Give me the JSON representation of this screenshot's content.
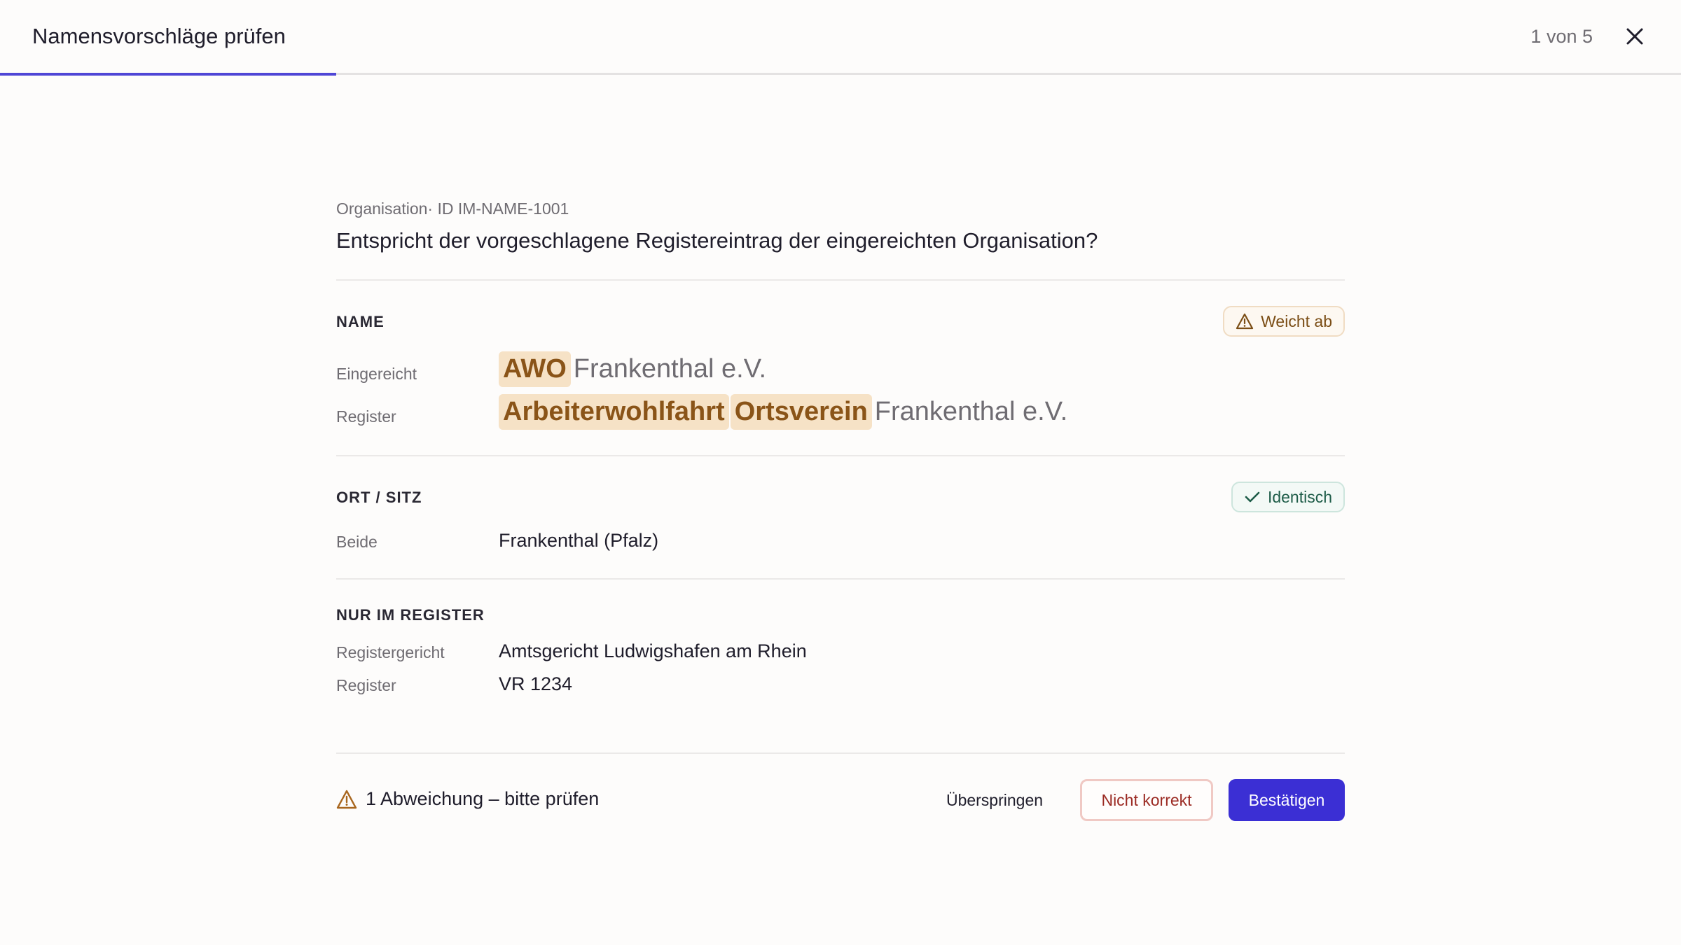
{
  "header": {
    "title": "Namensvorschläge prüfen",
    "counter": "1 von 5"
  },
  "progress": {
    "value": 0.2
  },
  "record": {
    "eyebrow": "Organisation· ID IM-NAME-1001",
    "question": "Entspricht der vorgeschlagene Registereintrag der eingereichten Organisation?"
  },
  "name_section": {
    "title": "NAME",
    "badge": "Weicht ab",
    "submitted_label": "Eingereicht",
    "submitted_highlight": "AWO",
    "submitted_rest": "Frankenthal e.V.",
    "register_label": "Register",
    "register_highlight_1": "Arbeiterwohlfahrt",
    "register_highlight_2": "Ortsverein",
    "register_rest": "Frankenthal e.V."
  },
  "location_section": {
    "title": "ORT / SITZ",
    "badge": "Identisch",
    "both_label": "Beide",
    "both_value": "Frankenthal (Pfalz)"
  },
  "register_only_section": {
    "title": "NUR IM REGISTER",
    "court_label": "Registergericht",
    "court_value": "Amtsgericht Ludwigshafen am Rhein",
    "register_label": "Register",
    "register_value": "VR 1234"
  },
  "footer": {
    "warning": "1 Abweichung – bitte prüfen",
    "skip_label": "Überspringen",
    "reject_label": "Nicht korrekt",
    "confirm_label": "Bestätigen"
  },
  "colors": {
    "accent": "#3b2fd4",
    "warn_highlight": "#f6e2c6",
    "warn_text": "#8a5418",
    "ok_text": "#1e5c48",
    "reject_border": "#f0c9c4"
  }
}
